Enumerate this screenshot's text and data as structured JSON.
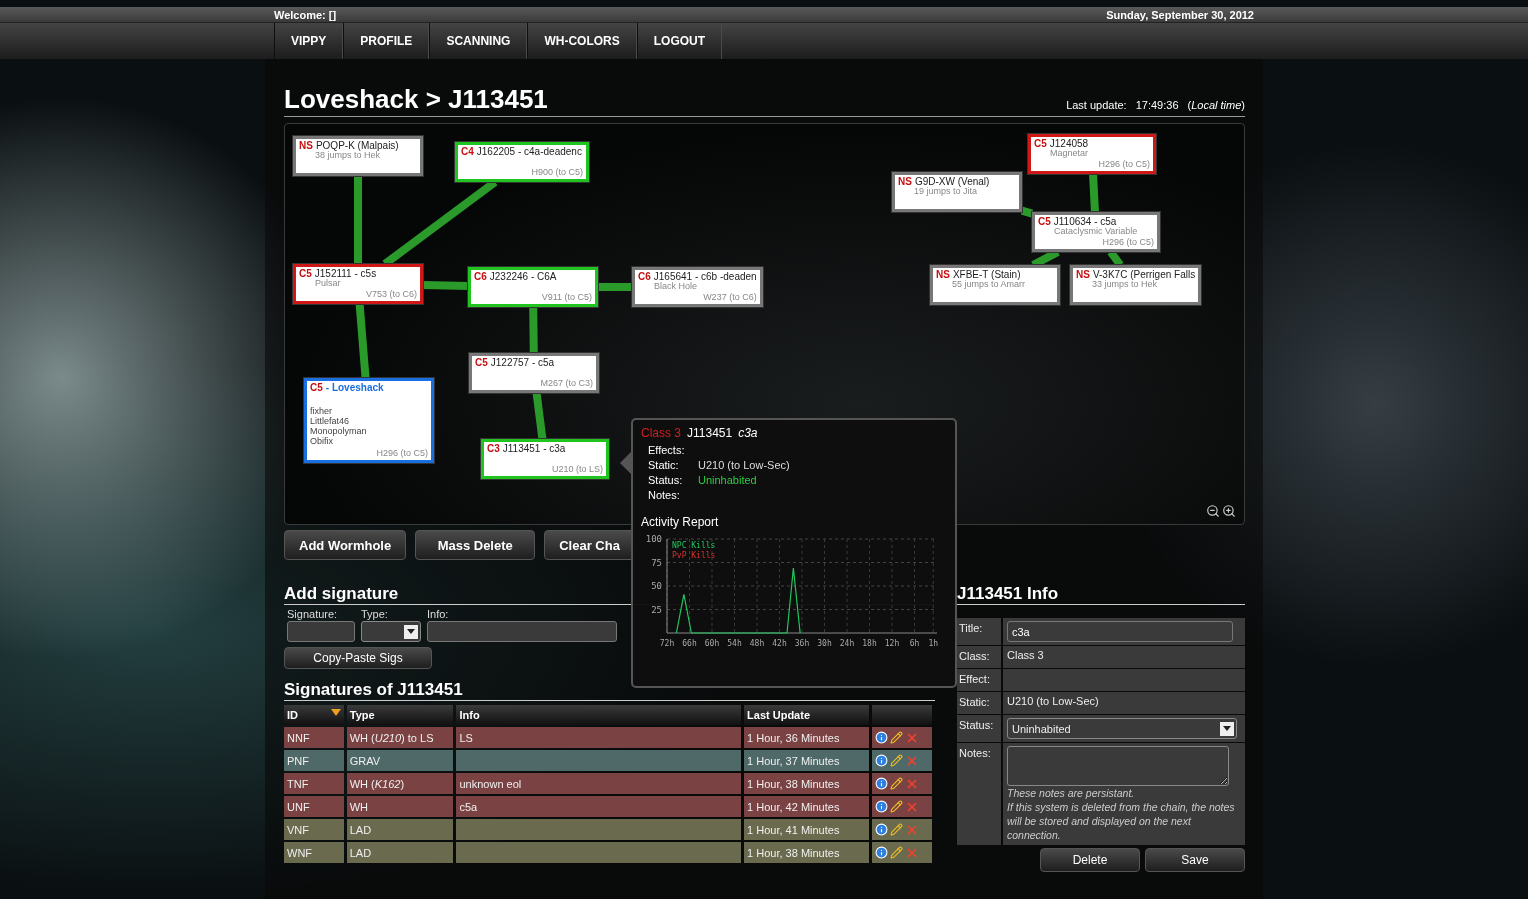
{
  "topbar": {
    "welcome": "Welcome: []",
    "date": "Sunday, September 30, 2012"
  },
  "nav": [
    "VIPPY",
    "PROFILE",
    "SCANNING",
    "WH-COLORS",
    "LOGOUT"
  ],
  "header": {
    "title": "Loveshack > J113451",
    "last_update_label": "Last update:",
    "last_update_time": "17:49:36",
    "time_zone": "(*Local time*)"
  },
  "map": {
    "chains": [
      {
        "home": true,
        "cls": "C5",
        "name": "- Loveshack",
        "color": "#1a6fe0",
        "static": "H296 (to C5)",
        "pilots": [
          "fixher",
          "Littlefat46",
          "Monopolyman",
          "Obifix"
        ],
        "children": [
          {
            "cls": "C5",
            "name": "J152111 - c5s",
            "sub": "Pulsar",
            "static": "V753 (to C6)",
            "color": "#d01818",
            "children": [
              {
                "cls": "NS",
                "name": "POQP-K  (Malpais)",
                "sub": "38 jumps to Hek",
                "color": "#777777"
              },
              {
                "cls": "C4",
                "name": "J162205 - c4a-deadenc",
                "static": "H900 (to C5)",
                "color": "#1fc41f"
              },
              {
                "cls": "C6",
                "name": "J232246 - C6A",
                "static": "V911 (to C5)",
                "color": "#1fc41f",
                "children": [
                  {
                    "cls": "C6",
                    "name": "J165641 - c6b -deaden",
                    "sub": "Black Hole",
                    "static": "W237 (to C6)",
                    "color": "#777777"
                  },
                  {
                    "cls": "C5",
                    "name": "J122757 - c5a",
                    "static": "M267 (to C3)",
                    "color": "#777777",
                    "children": [
                      {
                        "cls": "C3",
                        "name": "J113451 - c3a",
                        "static": "U210 (to LS)",
                        "color": "#1fc41f"
                      }
                    ]
                  }
                ]
              }
            ]
          }
        ]
      },
      {
        "cls": "C5",
        "name": "J110634 - c5a",
        "sub": "Cataclysmic Variable",
        "static": "H296 (to C5)",
        "color": "#777777",
        "children": [
          {
            "cls": "C5",
            "name": "J124058",
            "sub": "Magnetar",
            "static": "H296 (to C5)",
            "color": "#d01818"
          },
          {
            "cls": "NS",
            "name": "G9D-XW  (Venal)",
            "sub": "19 jumps to Jita",
            "color": "#777777"
          },
          {
            "cls": "NS",
            "name": "XFBE-T  (Stain)",
            "sub": "55 jumps to Amarr",
            "color": "#777777"
          },
          {
            "cls": "NS",
            "name": "V-3K7C  (Perrigen Falls",
            "sub": "33 jumps to Hek",
            "color": "#777777"
          }
        ]
      }
    ]
  },
  "map_buttons": [
    "Add Wormhole",
    "Mass Delete",
    "Clear Cha"
  ],
  "tooltip": {
    "cls": "Class 3",
    "system": "J113451",
    "title": "c3a",
    "rows": [
      {
        "label": "Effects:"
      },
      {
        "label": "Static:",
        "value": "U210 (to Low-Sec)",
        "kind": "plain"
      },
      {
        "label": "Status:",
        "value": "Uninhabited",
        "kind": "status"
      },
      {
        "label": "Notes:"
      }
    ],
    "chart_data": {
      "type": "line",
      "title": "Activity Report",
      "x": [
        69.5,
        67.5,
        65.5,
        40,
        38.3,
        36.5
      ],
      "series": [
        {
          "name": "NPC Kills",
          "color": "#22c55e",
          "values": [
            0,
            41,
            0,
            0,
            69,
            0
          ]
        },
        {
          "name": "PvP Kills",
          "color": "#e03030",
          "values": [
            null,
            null,
            null,
            null,
            null,
            null
          ]
        }
      ],
      "grid": true,
      "xlim": [
        72,
        0
      ],
      "ylim": [
        0,
        100
      ],
      "xticks": [
        {
          "value": 72,
          "label": "72h"
        },
        {
          "value": 66,
          "label": "66h"
        },
        {
          "value": 60,
          "label": "60h"
        },
        {
          "value": 54,
          "label": "54h"
        },
        {
          "value": 48,
          "label": "48h"
        },
        {
          "value": 42,
          "label": "42h"
        },
        {
          "value": 36,
          "label": "36h"
        },
        {
          "value": 30,
          "label": "30h"
        },
        {
          "value": 24,
          "label": "24h"
        },
        {
          "value": 18,
          "label": "18h"
        },
        {
          "value": 12,
          "label": "12h"
        },
        {
          "value": 6,
          "label": "6h"
        },
        {
          "value": 1,
          "label": "1h"
        }
      ],
      "yticks": [
        25,
        50,
        75,
        100
      ]
    }
  },
  "add_signature": {
    "title": "Add signature",
    "fields": [
      {
        "label": "Signature:",
        "kind": "text"
      },
      {
        "label": "Type:",
        "kind": "select"
      },
      {
        "label": "Info:",
        "kind": "text"
      }
    ],
    "copy_button": "Copy-Paste Sigs"
  },
  "signatures": {
    "title": "Signatures of J113451",
    "columns": [
      {
        "label": "ID",
        "sorted": true
      },
      {
        "label": "Type",
        "sorted": false
      },
      {
        "label": "Info",
        "sorted": false
      },
      {
        "label": "Last Update",
        "sorted": false
      }
    ],
    "rows": [
      {
        "id": "NNF",
        "type": "WH  (*U210*) to LS",
        "info": "LS",
        "updated": "1 Hour, 36 Minutes",
        "color": "#7a4242"
      },
      {
        "id": "PNF",
        "type": "GRAV",
        "updated": "1 Hour, 37 Minutes",
        "color": "#4f6868"
      },
      {
        "id": "TNF",
        "type": "WH  (*K162*)",
        "info": "unknown eol",
        "updated": "1 Hour, 38 Minutes",
        "color": "#7a4242"
      },
      {
        "id": "UNF",
        "type": "WH",
        "info": "c5a",
        "updated": "1 Hour, 42 Minutes",
        "color": "#7a4242"
      },
      {
        "id": "VNF",
        "type": "LAD",
        "updated": "1 Hour, 41 Minutes",
        "color": "#6a6a4e"
      },
      {
        "id": "WNF",
        "type": "LAD",
        "updated": "1 Hour, 38 Minutes",
        "color": "#6a6a4e"
      }
    ]
  },
  "info_panel": {
    "title": "J113451 Info",
    "rows": [
      {
        "label": "Title:",
        "kind": "input",
        "value": "c3a"
      },
      {
        "label": "Class:",
        "kind": "text",
        "value": "Class 3"
      },
      {
        "label": "Effect:",
        "kind": "text"
      },
      {
        "label": "Static:",
        "kind": "text",
        "value": "U210 (to Low-Sec)"
      },
      {
        "label": "Status:",
        "kind": "select",
        "value": "Uninhabited"
      },
      {
        "label": "Notes:",
        "kind": "notes",
        "hints": [
          "These notes are persistant.",
          "If this system is deleted from the chain, the notes will be stored and displayed on the next connection."
        ]
      }
    ],
    "buttons": [
      "Delete",
      "Save"
    ]
  }
}
